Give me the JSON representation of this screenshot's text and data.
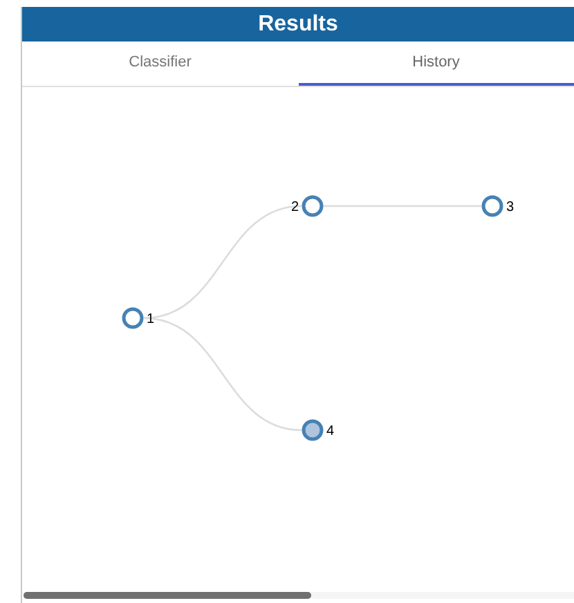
{
  "header": {
    "title": "Results"
  },
  "tabs": [
    {
      "label": "Classifier",
      "selected": false
    },
    {
      "label": "History",
      "selected": true
    }
  ],
  "tree": {
    "label": "1",
    "selected": false,
    "children": [
      {
        "label": "2",
        "selected": false,
        "children": [
          {
            "label": "3",
            "selected": false
          }
        ]
      },
      {
        "label": "4",
        "selected": true
      }
    ]
  }
}
